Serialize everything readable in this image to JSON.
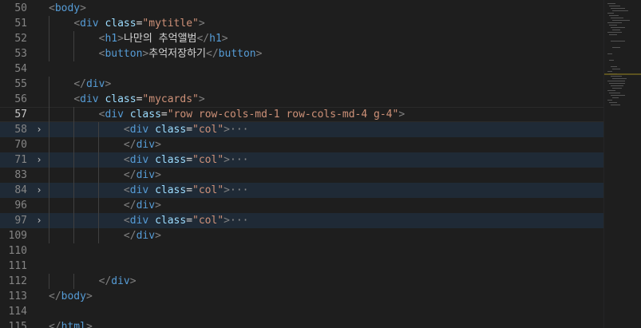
{
  "editor": {
    "lines": [
      {
        "num": "50",
        "tokens": [
          [
            "t",
            "<"
          ],
          [
            "tn",
            "body"
          ],
          [
            "t",
            ">"
          ]
        ]
      },
      {
        "num": "51",
        "tokens": [
          [
            "sp",
            "    "
          ],
          [
            "t",
            "<"
          ],
          [
            "tn",
            "div"
          ],
          [
            "sp",
            " "
          ],
          [
            "an",
            "class"
          ],
          [
            "tx",
            "="
          ],
          [
            "av",
            "\"mytitle\""
          ],
          [
            "t",
            ">"
          ]
        ]
      },
      {
        "num": "52",
        "tokens": [
          [
            "sp",
            "        "
          ],
          [
            "t",
            "<"
          ],
          [
            "tn",
            "h1"
          ],
          [
            "t",
            ">"
          ],
          [
            "tx",
            "나만의 추억앨범"
          ],
          [
            "t",
            "</"
          ],
          [
            "tn",
            "h1"
          ],
          [
            "t",
            ">"
          ]
        ]
      },
      {
        "num": "53",
        "tokens": [
          [
            "sp",
            "        "
          ],
          [
            "t",
            "<"
          ],
          [
            "tn",
            "button"
          ],
          [
            "t",
            ">"
          ],
          [
            "tx",
            "추억저장하기"
          ],
          [
            "t",
            "</"
          ],
          [
            "tn",
            "button"
          ],
          [
            "t",
            ">"
          ]
        ]
      },
      {
        "num": "54",
        "tokens": []
      },
      {
        "num": "55",
        "tokens": [
          [
            "sp",
            "    "
          ],
          [
            "t",
            "</"
          ],
          [
            "tn",
            "div"
          ],
          [
            "t",
            ">"
          ]
        ]
      },
      {
        "num": "56",
        "tokens": [
          [
            "sp",
            "    "
          ],
          [
            "t",
            "<"
          ],
          [
            "tn",
            "div"
          ],
          [
            "sp",
            " "
          ],
          [
            "an",
            "class"
          ],
          [
            "tx",
            "="
          ],
          [
            "av",
            "\"mycards\""
          ],
          [
            "t",
            ">"
          ]
        ]
      },
      {
        "num": "57",
        "current": true,
        "tokens": [
          [
            "sp",
            "        "
          ],
          [
            "t",
            "<"
          ],
          [
            "tn",
            "div"
          ],
          [
            "sp",
            " "
          ],
          [
            "an",
            "class"
          ],
          [
            "tx",
            "="
          ],
          [
            "av",
            "\"row row-cols-md-1 row-cols-md-4 g-4\""
          ],
          [
            "t",
            ">"
          ]
        ]
      },
      {
        "num": "58",
        "folded": true,
        "fold": "›",
        "tokens": [
          [
            "sp",
            "            "
          ],
          [
            "t",
            "<"
          ],
          [
            "tn",
            "div"
          ],
          [
            "sp",
            " "
          ],
          [
            "an",
            "class"
          ],
          [
            "tx",
            "="
          ],
          [
            "av",
            "\"col\""
          ],
          [
            "t",
            ">"
          ],
          [
            "el",
            "···"
          ]
        ]
      },
      {
        "num": "70",
        "tokens": [
          [
            "sp",
            "            "
          ],
          [
            "t",
            "</"
          ],
          [
            "tn",
            "div"
          ],
          [
            "t",
            ">"
          ]
        ]
      },
      {
        "num": "71",
        "folded": true,
        "fold": "›",
        "tokens": [
          [
            "sp",
            "            "
          ],
          [
            "t",
            "<"
          ],
          [
            "tn",
            "div"
          ],
          [
            "sp",
            " "
          ],
          [
            "an",
            "class"
          ],
          [
            "tx",
            "="
          ],
          [
            "av",
            "\"col\""
          ],
          [
            "t",
            ">"
          ],
          [
            "el",
            "···"
          ]
        ]
      },
      {
        "num": "83",
        "tokens": [
          [
            "sp",
            "            "
          ],
          [
            "t",
            "</"
          ],
          [
            "tn",
            "div"
          ],
          [
            "t",
            ">"
          ]
        ]
      },
      {
        "num": "84",
        "folded": true,
        "fold": "›",
        "tokens": [
          [
            "sp",
            "            "
          ],
          [
            "t",
            "<"
          ],
          [
            "tn",
            "div"
          ],
          [
            "sp",
            " "
          ],
          [
            "an",
            "class"
          ],
          [
            "tx",
            "="
          ],
          [
            "av",
            "\"col\""
          ],
          [
            "t",
            ">"
          ],
          [
            "el",
            "···"
          ]
        ]
      },
      {
        "num": "96",
        "tokens": [
          [
            "sp",
            "            "
          ],
          [
            "t",
            "</"
          ],
          [
            "tn",
            "div"
          ],
          [
            "t",
            ">"
          ]
        ]
      },
      {
        "num": "97",
        "folded": true,
        "fold": "›",
        "tokens": [
          [
            "sp",
            "            "
          ],
          [
            "t",
            "<"
          ],
          [
            "tn",
            "div"
          ],
          [
            "sp",
            " "
          ],
          [
            "an",
            "class"
          ],
          [
            "tx",
            "="
          ],
          [
            "av",
            "\"col\""
          ],
          [
            "t",
            ">"
          ],
          [
            "el",
            "···"
          ]
        ]
      },
      {
        "num": "109",
        "tokens": [
          [
            "sp",
            "            "
          ],
          [
            "t",
            "</"
          ],
          [
            "tn",
            "div"
          ],
          [
            "t",
            ">"
          ]
        ]
      },
      {
        "num": "110",
        "tokens": []
      },
      {
        "num": "111",
        "tokens": []
      },
      {
        "num": "112",
        "tokens": [
          [
            "sp",
            "        "
          ],
          [
            "t",
            "</"
          ],
          [
            "tn",
            "div"
          ],
          [
            "t",
            ">"
          ]
        ]
      },
      {
        "num": "113",
        "tokens": [
          [
            "t",
            "</"
          ],
          [
            "tn",
            "body"
          ],
          [
            "t",
            ">"
          ]
        ]
      },
      {
        "num": "114",
        "tokens": []
      },
      {
        "num": "115",
        "tokens": [
          [
            "t",
            "</"
          ],
          [
            "tn",
            "html"
          ],
          [
            "t",
            ">"
          ]
        ]
      }
    ]
  },
  "colors": {
    "background": "#1e1e1e",
    "tag_name": "#569cd6",
    "attr_name": "#9cdcfe",
    "attr_value": "#ce9178",
    "bracket": "#808080",
    "text": "#d4d4d4",
    "folded_line_bg": "#1f2a36"
  },
  "icons": {
    "fold": "chevron-right-icon"
  }
}
